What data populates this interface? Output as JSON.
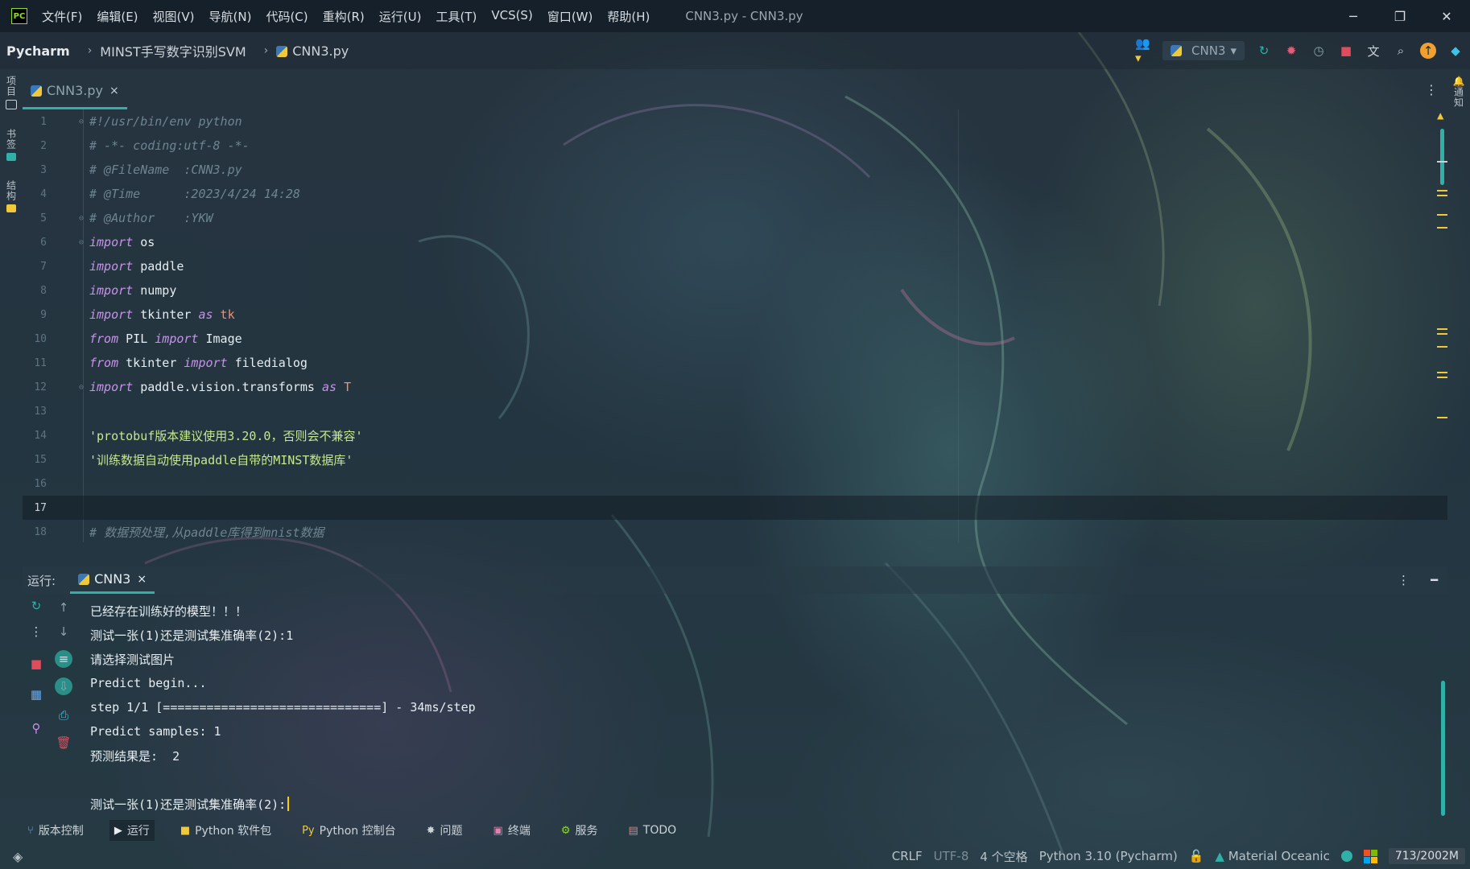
{
  "titlebar": {
    "logo": "PC",
    "menu": [
      "文件(F)",
      "编辑(E)",
      "视图(V)",
      "导航(N)",
      "代码(C)",
      "重构(R)",
      "运行(U)",
      "工具(T)",
      "VCS(S)",
      "窗口(W)",
      "帮助(H)"
    ],
    "window_title": "CNN3.py - CNN3.py",
    "controls": [
      "─",
      "❐",
      "✕"
    ]
  },
  "navbar": {
    "root": "Pycharm",
    "project": "MINST手写数字识别SVM",
    "file": "CNN3.py",
    "run_config": "CNN3"
  },
  "left_strip": [
    "项目",
    "书签",
    "结构"
  ],
  "right_strip": [
    "通知"
  ],
  "editor_tab": {
    "label": "CNN3.py",
    "close": "×"
  },
  "editor": {
    "line_numbers": [
      "1",
      "2",
      "3",
      "4",
      "5",
      "6",
      "7",
      "8",
      "9",
      "10",
      "11",
      "12",
      "13",
      "14",
      "15",
      "16",
      "17",
      "18"
    ],
    "lines": [
      [
        {
          "t": "cm",
          "v": "#!/usr/bin/env python"
        }
      ],
      [
        {
          "t": "cm",
          "v": "# -*- coding:utf-8 -*-"
        }
      ],
      [
        {
          "t": "cm",
          "v": "# @FileName  :CNN3.py"
        }
      ],
      [
        {
          "t": "cm",
          "v": "# @Time      :2023/4/24 14:28"
        }
      ],
      [
        {
          "t": "cm",
          "v": "# @Author    :YKW"
        }
      ],
      [
        {
          "t": "kw",
          "v": "import"
        },
        {
          "t": "id",
          "v": " os"
        }
      ],
      [
        {
          "t": "kw",
          "v": "import"
        },
        {
          "t": "id",
          "v": " paddle"
        }
      ],
      [
        {
          "t": "kw",
          "v": "import"
        },
        {
          "t": "id",
          "v": " numpy"
        }
      ],
      [
        {
          "t": "kw",
          "v": "import"
        },
        {
          "t": "id",
          "v": " tkinter "
        },
        {
          "t": "kw",
          "v": "as"
        },
        {
          "t": "al",
          "v": " tk"
        }
      ],
      [
        {
          "t": "kw",
          "v": "from"
        },
        {
          "t": "id",
          "v": " PIL "
        },
        {
          "t": "kw",
          "v": "import"
        },
        {
          "t": "id",
          "v": " Image"
        }
      ],
      [
        {
          "t": "kw",
          "v": "from"
        },
        {
          "t": "id",
          "v": " tkinter "
        },
        {
          "t": "kw",
          "v": "import"
        },
        {
          "t": "id",
          "v": " filedialog"
        }
      ],
      [
        {
          "t": "kw",
          "v": "import"
        },
        {
          "t": "id",
          "v": " paddle.vision.transforms "
        },
        {
          "t": "kw",
          "v": "as"
        },
        {
          "t": "al",
          "v": " T"
        }
      ],
      [],
      [
        {
          "t": "str",
          "v": "'protobuf版本建议使用3.20.0，否则会不兼容'"
        }
      ],
      [
        {
          "t": "str",
          "v": "'训练数据自动使用paddle自带的MINST数据库'"
        }
      ],
      [],
      [],
      [
        {
          "t": "cm",
          "v": "# 数据预处理,从paddle库得到mnist数据"
        }
      ]
    ],
    "current_line": 17
  },
  "run_panel": {
    "label": "运行:",
    "tab": "CNN3",
    "close": "×",
    "console": [
      "已经存在训练好的模型！！！",
      "测试一张(1)还是测试集准确率(2):1",
      "请选择测试图片",
      "Predict begin...",
      "step 1/1 [==============================] - 34ms/step",
      "Predict samples: 1",
      "预测结果是:  2",
      "",
      "测试一张(1)还是测试集准确率(2):"
    ]
  },
  "toolwindows": [
    {
      "icon": "⑂",
      "label": "版本控制",
      "active": false,
      "color": "#6aa9e9"
    },
    {
      "icon": "▶",
      "label": "运行",
      "active": true,
      "color": "#e6edf1"
    },
    {
      "icon": "■",
      "label": "Python 软件包",
      "active": false,
      "color": "#f0c93a"
    },
    {
      "icon": "Py",
      "label": "Python 控制台",
      "active": false,
      "color": "#f0c93a"
    },
    {
      "icon": "✸",
      "label": "问题",
      "active": false,
      "color": "#cbd3d9"
    },
    {
      "icon": "▣",
      "label": "终端",
      "active": false,
      "color": "#e07fb0"
    },
    {
      "icon": "⚙",
      "label": "服务",
      "active": false,
      "color": "#8fdc2c"
    },
    {
      "icon": "▤",
      "label": "TODO",
      "active": false,
      "color": "#e07f7f"
    }
  ],
  "statusbar": {
    "line_sep": "CRLF",
    "encoding": "UTF-8",
    "indent": "4 个空格",
    "interpreter": "Python 3.10 (Pycharm)",
    "theme": "Material Oceanic",
    "memory": "713/2002M"
  },
  "colors": {
    "accent": "#2fb1a7",
    "caret": "#ffcc00",
    "warning": "#f0c93a"
  }
}
